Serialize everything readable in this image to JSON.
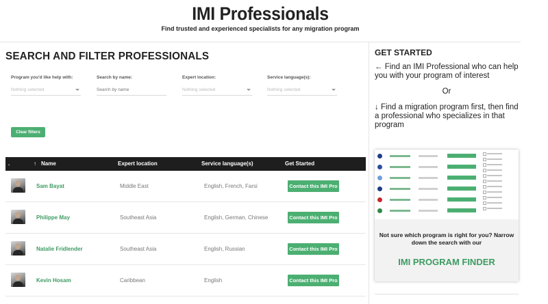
{
  "header": {
    "title": "IMI Professionals",
    "subtitle": "Find trusted and experienced specialists for any migration program"
  },
  "search": {
    "section_title": "SEARCH AND FILTER PROFESSIONALS",
    "filters": [
      {
        "label": "Program you'd like help with:",
        "value": "Nothing selected",
        "type": "select"
      },
      {
        "label": "Search by name:",
        "placeholder": "Search by name",
        "type": "text"
      },
      {
        "label": "Expert location:",
        "value": "Nothing selected",
        "type": "select"
      },
      {
        "label": "Service language(s):",
        "value": "Nothing selected",
        "type": "select"
      }
    ],
    "clear_label": "Clear filters"
  },
  "table": {
    "headers": {
      "dot": ".",
      "sort_icon": "↑",
      "name": "Name",
      "location": "Expert location",
      "language": "Service language(s)",
      "action": "Get Started"
    },
    "rows": [
      {
        "name": "Sam Bayat",
        "location": "Middle East",
        "languages": "English, French, Farsi",
        "button": "Contact this IMI Pro"
      },
      {
        "name": "Philippe May",
        "location": "Southeast Asia",
        "languages": "English, German, Chinese",
        "button": "Contact this IMI Pro"
      },
      {
        "name": "Natalie Fridlender",
        "location": "Southeast Asia",
        "languages": "English, Russian",
        "button": "Contact this IMI Pro"
      },
      {
        "name": "Kevin Hosam",
        "location": "Caribbean",
        "languages": "English",
        "button": "Contact this IMI Pro"
      }
    ]
  },
  "sidebar": {
    "title": "GET STARTED",
    "text1": "← Find an IMI Professional who can help you with your program of interest",
    "or": "Or",
    "text2": "↓ Find a migration program first, then find a professional who specializes in that program",
    "card": {
      "question": "Not sure which program is right for you? Narrow down the search with our",
      "finder": "IMI PROGRAM FINDER"
    }
  },
  "colors": {
    "accent": "#4caf72",
    "link": "#3d9b62",
    "table_header": "#1e1e1e"
  }
}
